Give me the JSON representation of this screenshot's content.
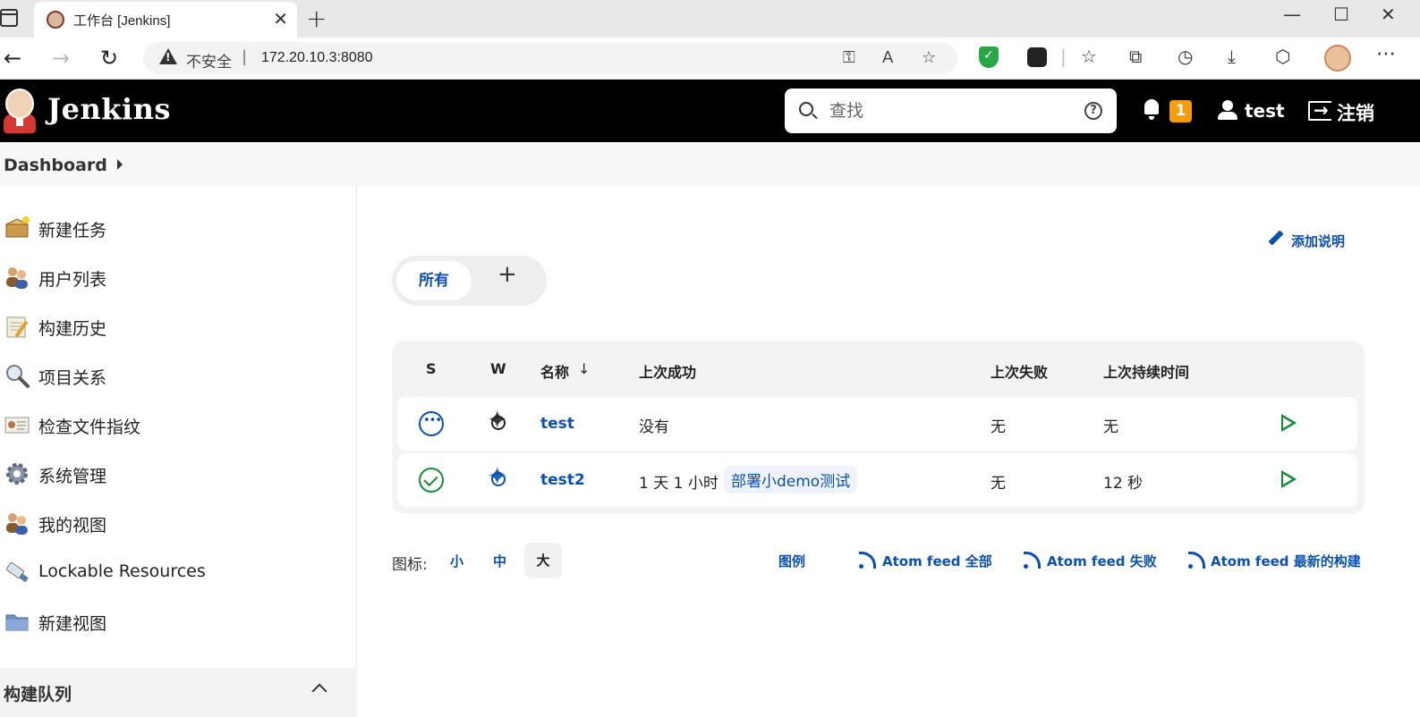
{
  "browser": {
    "tab_title": "工作台 [Jenkins]",
    "tab_close": "✕",
    "new_tab": "+",
    "window_controls": [
      "—",
      "☐",
      "✕"
    ],
    "insecure_label": "不安全",
    "url_separator": "|",
    "url": "172.20.10.3:8080",
    "more": "⋯"
  },
  "header": {
    "title": "Jenkins",
    "search_placeholder": "查找",
    "help": "?",
    "notification_count": "1",
    "user": "test",
    "logout": "注销"
  },
  "breadcrumb": {
    "dashboard": "Dashboard"
  },
  "sidebar": {
    "items": [
      {
        "label": "新建任务",
        "icon": "new-item-icon"
      },
      {
        "label": "用户列表",
        "icon": "people-icon"
      },
      {
        "label": "构建历史",
        "icon": "notepad-icon"
      },
      {
        "label": "项目关系",
        "icon": "magnifier-icon"
      },
      {
        "label": "检查文件指纹",
        "icon": "fingerprint-icon"
      },
      {
        "label": "系统管理",
        "icon": "gear-icon"
      },
      {
        "label": "我的视图",
        "icon": "user-icon"
      },
      {
        "label": "Lockable Resources",
        "icon": "usb-icon"
      },
      {
        "label": "新建视图",
        "icon": "folder-icon"
      }
    ],
    "queue_title": "构建队列"
  },
  "main": {
    "add_description": "添加说明",
    "tabs": {
      "all": "所有",
      "add": "+"
    },
    "table": {
      "headers": {
        "s": "S",
        "w": "W",
        "name": "名称",
        "sort": "↓",
        "last_success": "上次成功",
        "last_failure": "上次失败",
        "last_duration": "上次持续时间"
      },
      "rows": [
        {
          "name": "test",
          "last_success": "没有",
          "build_tag": "",
          "last_failure": "无",
          "last_duration": "无",
          "status": "pending",
          "weather_color": "#222222"
        },
        {
          "name": "test2",
          "last_success": "1 天 1 小时",
          "build_tag": "部署小demo测试",
          "last_failure": "无",
          "last_duration": "12 秒",
          "status": "success",
          "weather_color": "#0a50b0"
        }
      ]
    },
    "footer": {
      "icon_label": "图标:",
      "sizes": {
        "small": "小",
        "medium": "中",
        "large": "大"
      },
      "legend": "图例",
      "feed_all": "Atom feed 全部",
      "feed_failed": "Atom feed 失败",
      "feed_latest": "Atom feed 最新的构建"
    }
  },
  "colors": {
    "header_bg": "#000000",
    "link": "#0a50b0",
    "success": "#138a36",
    "badge": "#f59d09"
  }
}
